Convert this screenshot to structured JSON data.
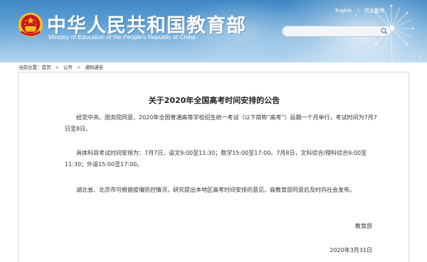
{
  "header": {
    "site_title": "中华人民共和国教育部",
    "site_subtitle": "Ministry of Education of the People's Republic of China",
    "links": [
      "English",
      "信息教育"
    ],
    "search": {
      "value": "",
      "placeholder": ""
    }
  },
  "breadcrumb": {
    "label": "当前位置：",
    "items": [
      "首页",
      "公开",
      "通知通告"
    ]
  },
  "article": {
    "title": "关于2020年全国高考时间安排的公告",
    "paragraphs": [
      "经党中央、国务院同意，2020年全国普通高等学校招生统一考试（以下简称“高考”）延期一个月举行，考试时间为7月7日至8日。",
      "具体科目考试时间安排为：7月7日，语文9:00至11:30；数学15:00至17:00。7月8日，文科综合/理科综合9:00至11:30；外语15:00至17:00。",
      "湖北省、北京市可根据疫情防控情况，研究提出本地区高考时间安排的意见，商教育部同意后及时向社会发布。"
    ],
    "signer": "教育部",
    "date": "2020年3月31日"
  },
  "colors": {
    "header_blue": "#3f88c5",
    "emblem_red": "#c8161d",
    "emblem_gold": "#f2c31b"
  }
}
